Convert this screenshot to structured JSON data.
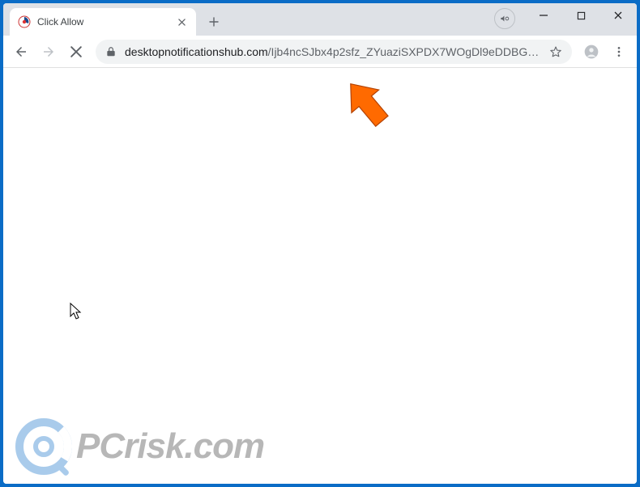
{
  "window": {
    "tab_title": "Click Allow"
  },
  "address": {
    "domain": "desktopnotificationshub.com",
    "path": "/Ijb4ncSJbx4p2sfz_ZYuaziSXPDX7WOgDl9eDDBGe..."
  },
  "icons": {
    "back": "back-icon",
    "forward": "forward-icon",
    "stop": "close-icon",
    "lock": "lock-icon",
    "star": "star-icon",
    "profile": "profile-icon",
    "menu": "menu-icon",
    "newtab": "plus-icon",
    "tabclose": "close-icon",
    "min": "minimize-icon",
    "max": "maximize-icon",
    "winclose": "close-icon",
    "media": "media-control-icon"
  },
  "watermark": {
    "text": "PCrisk.com"
  }
}
